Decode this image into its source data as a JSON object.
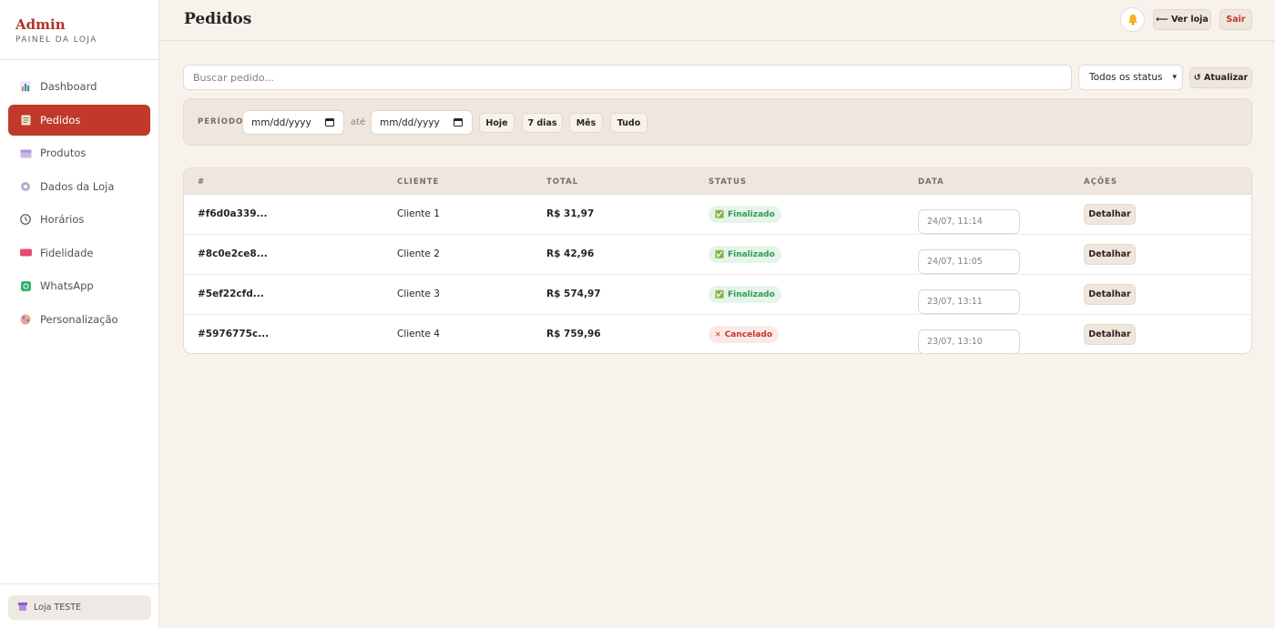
{
  "brand": {
    "title": "Admin",
    "subtitle": "PAINEL DA LOJA"
  },
  "sidebar": {
    "items": [
      {
        "label": "Dashboard",
        "icon": "bar-chart-icon"
      },
      {
        "label": "Pedidos",
        "icon": "receipt-icon",
        "active": true
      },
      {
        "label": "Produtos",
        "icon": "box-icon"
      },
      {
        "label": "Dados da Loja",
        "icon": "gear-icon"
      },
      {
        "label": "Horários",
        "icon": "clock-icon"
      },
      {
        "label": "Fidelidade",
        "icon": "ticket-icon"
      },
      {
        "label": "WhatsApp",
        "icon": "whatsapp-icon"
      },
      {
        "label": "Personalização",
        "icon": "palette-icon"
      }
    ],
    "store_label": "Loja TESTE"
  },
  "header": {
    "title": "Pedidos",
    "ver_loja": "⟵ Ver loja",
    "sair": "Sair"
  },
  "search": {
    "placeholder": "Buscar pedido..."
  },
  "status_filter": {
    "selected": "Todos os status"
  },
  "refresh_label": "↺ Atualizar",
  "filter": {
    "periodo_label": "PERÍODO",
    "date_from": "mm/dd/yyyy",
    "ate_label": "até",
    "date_to": "mm/dd/yyyy",
    "quick": [
      "Hoje",
      "7 dias",
      "Mês",
      "Tudo"
    ]
  },
  "table": {
    "headers": [
      "#",
      "CLIENTE",
      "TOTAL",
      "STATUS",
      "DATA",
      "AÇÕES"
    ],
    "rows": [
      {
        "id": "#f6d0a339...",
        "cliente": "Cliente 1",
        "total": "R$ 31,97",
        "status": "Finalizado",
        "data": "24/07, 11:14",
        "acao": "Detalhar"
      },
      {
        "id": "#8c0e2ce8...",
        "cliente": "Cliente 2",
        "total": "R$ 42,96",
        "status": "Finalizado",
        "data": "24/07, 11:05",
        "acao": "Detalhar"
      },
      {
        "id": "#5ef22cfd...",
        "cliente": "Cliente 3",
        "total": "R$ 574,97",
        "status": "Finalizado",
        "data": "23/07, 13:11",
        "acao": "Detalhar"
      },
      {
        "id": "#5976775c...",
        "cliente": "Cliente 4",
        "total": "R$ 759,96",
        "status": "Cancelado",
        "data": "23/07, 13:10",
        "acao": "Detalhar"
      }
    ]
  },
  "colors": {
    "accent": "#c0392b",
    "success": "#2e9a55",
    "background": "#f7f2ec"
  }
}
